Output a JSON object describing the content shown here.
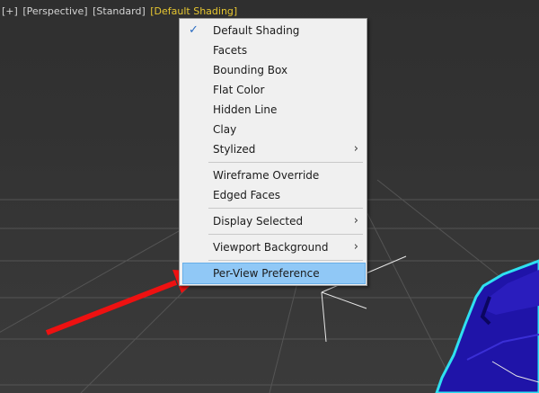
{
  "viewport_labels": {
    "plus": "[+]",
    "view": "[Perspective]",
    "style": "[Standard]",
    "shading": "[Default Shading]"
  },
  "menu": {
    "items": [
      {
        "label": "Default Shading",
        "checked": true
      },
      {
        "label": "Facets"
      },
      {
        "label": "Bounding Box"
      },
      {
        "label": "Flat Color"
      },
      {
        "label": "Hidden Line"
      },
      {
        "label": "Clay"
      },
      {
        "label": "Stylized",
        "submenu": true
      },
      {
        "label": "Wireframe Override"
      },
      {
        "label": "Edged Faces"
      },
      {
        "label": "Display Selected",
        "submenu": true
      },
      {
        "label": "Viewport Background",
        "submenu": true
      },
      {
        "label": "Per-View Preference",
        "highlighted": true
      }
    ],
    "check_glyph": "✓",
    "submenu_glyph": "›"
  },
  "colors": {
    "shading_label": "#e6c631",
    "highlight": "#90c8f6",
    "object": "#1f14a8",
    "selection_outline": "#2fe0f0",
    "arrow": "#ee1111"
  }
}
